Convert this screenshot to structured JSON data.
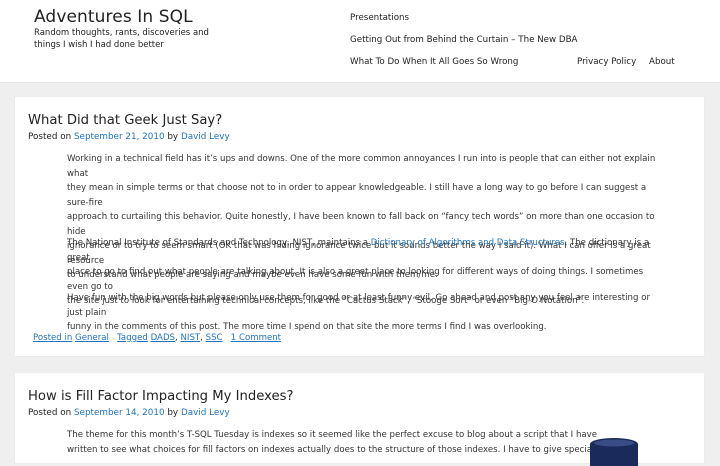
{
  "site": {
    "title": "Adventures In SQL",
    "description": "Random thoughts, rants, discoveries and things I wish I had done better"
  },
  "nav": {
    "items": [
      {
        "label": "Presentations"
      },
      {
        "label": "Getting Out from Behind the Curtain – The New DBA"
      },
      {
        "label": "What To Do When It All Goes So Wrong"
      },
      {
        "label": "Privacy Policy"
      },
      {
        "label": "About"
      }
    ]
  },
  "posts": [
    {
      "title": "What Did that Geek Just Say?",
      "posted_on": "Posted on",
      "date": "September 21, 2010",
      "by": "by",
      "author": "David Levy",
      "paragraphs": [
        {
          "lines": [
            "Working in a technical field has it’s ups and downs. One of the more common annoyances I run into is people that can either not explain what",
            "they mean in simple terms or that choose not to in order to appear knowledgeable. I still have a long way to go before I can suggest a sure-fire",
            "approach to curtailing this behavior. Quite honestly, I have been known to fall back on “fancy tech words” on more than one occasion to hide",
            "ignorance or to try to seem smart (OK that was hiding ignorance twice but it sounds better the way I said it). What I can offer is a great resource",
            "to understand what people are saying and maybe even have some fun with them/me."
          ]
        },
        {
          "line1_pre": "The National Institute of Standards and Technology, NIST, maintains a ",
          "link": "Dictionary of Algorithms and Data Structures",
          "line1_post": ". The dictionary is a great",
          "lines": [
            "place to go to find out what people are talking about. It is also a great place to looking for different ways of doing things. I sometimes even go to",
            "the site just to look for entertaining technical concepts, like the “Cactus Stack”, “Stooge Sort” or even “Big-O Notation”."
          ]
        },
        {
          "lines": [
            "Have fun with the big words but please only use them for good or at least funny evil. Go ahead and post any you feel are interesting or just plain",
            "funny in the comments of this post. The more time I spend on that site the more terms I find I was overlooking."
          ]
        }
      ],
      "footer": {
        "posted_in": "Posted in",
        "category": "General",
        "tagged": "Tagged",
        "tags": [
          "DADS",
          "NIST",
          "SSC"
        ],
        "comments": "1 Comment"
      }
    },
    {
      "title": "How is Fill Factor Impacting My Indexes?",
      "posted_on": "Posted on",
      "date": "September 14, 2010",
      "by": "by",
      "author": "David Levy",
      "paragraphs": [
        {
          "lines": [
            "The theme for this month’s T-SQL Tuesday is indexes so it seemed like the perfect excuse to blog about a script that I have",
            "written to see what choices for fill factors on indexes actually does to the structure of those indexes. I have to give special"
          ]
        }
      ],
      "icon": "database-icon",
      "icon_color": "#1a2a5a"
    }
  ]
}
